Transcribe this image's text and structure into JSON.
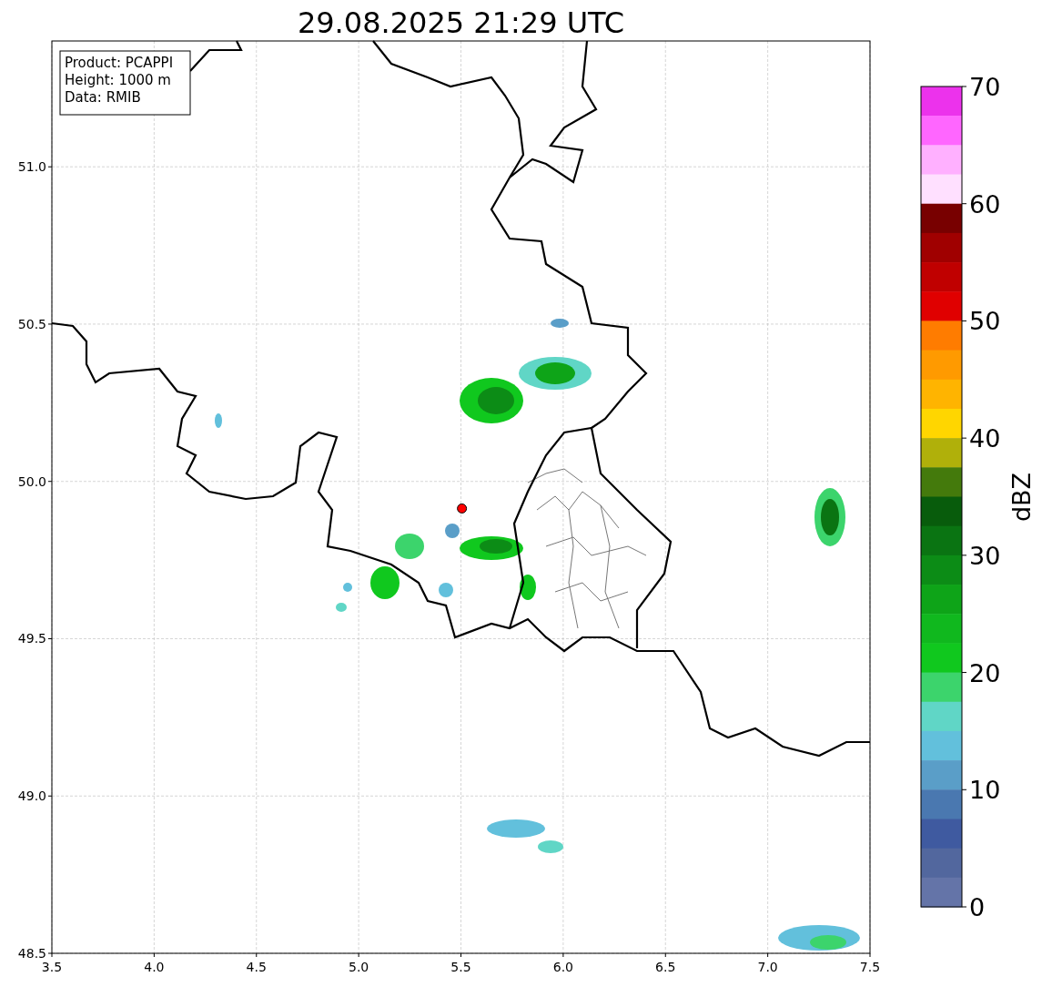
{
  "title": "29.08.2025 21:29 UTC",
  "map": {
    "info_lines": [
      "Product: PCAPPI",
      "Height: 1000 m",
      "Data: RMIB"
    ],
    "chart_data": {
      "type": "scatter",
      "xlim": [
        3.5,
        7.5
      ],
      "ylim": [
        48.5,
        51.4
      ],
      "xticks": [
        {
          "value": 3.5,
          "label": "3.5"
        },
        {
          "value": 4.0,
          "label": "4.0"
        },
        {
          "value": 4.5,
          "label": "4.5"
        },
        {
          "value": 5.0,
          "label": "5.0"
        },
        {
          "value": 5.5,
          "label": "5.5"
        },
        {
          "value": 6.0,
          "label": "6.0"
        },
        {
          "value": 6.5,
          "label": "6.5"
        },
        {
          "value": 7.0,
          "label": "7.0"
        },
        {
          "value": 7.5,
          "label": "7.5"
        }
      ],
      "yticks": [
        {
          "value": 48.5,
          "label": "48.5"
        },
        {
          "value": 49.0,
          "label": "49.0"
        },
        {
          "value": 49.5,
          "label": "49.5"
        },
        {
          "value": 50.0,
          "label": "50.0"
        },
        {
          "value": 50.5,
          "label": "50.5"
        },
        {
          "value": 51.0,
          "label": "51.0"
        }
      ],
      "grid": true,
      "x": [
        5.505
      ],
      "series": [
        {
          "color": "#ff0000",
          "values": [
            49.914
          ]
        }
      ]
    }
  },
  "colorbar": {
    "label": "dBZ",
    "ticks": [
      "70",
      "60",
      "50",
      "40",
      "30",
      "20",
      "10",
      "0"
    ],
    "segments": [
      {
        "color": "#ec32ec"
      },
      {
        "color": "#ff66ff"
      },
      {
        "color": "#ffb0ff"
      },
      {
        "color": "#ffe0ff"
      },
      {
        "color": "#780000"
      },
      {
        "color": "#a00000"
      },
      {
        "color": "#c00000"
      },
      {
        "color": "#e00000"
      },
      {
        "color": "#ff7c00"
      },
      {
        "color": "#ff9a00"
      },
      {
        "color": "#ffb400"
      },
      {
        "color": "#ffd600"
      },
      {
        "color": "#b0b00a"
      },
      {
        "color": "#447a0c"
      },
      {
        "color": "#085c0c"
      },
      {
        "color": "#0a7412"
      },
      {
        "color": "#0c8c16"
      },
      {
        "color": "#0ea418"
      },
      {
        "color": "#10b81e"
      },
      {
        "color": "#10c81e"
      },
      {
        "color": "#3cd46c"
      },
      {
        "color": "#60d6c6"
      },
      {
        "color": "#62c0dc"
      },
      {
        "color": "#5a9ec8"
      },
      {
        "color": "#4a78b0"
      },
      {
        "color": "#3f5aa0"
      },
      {
        "color": "#52679e"
      },
      {
        "color": "#6474a8"
      }
    ]
  }
}
